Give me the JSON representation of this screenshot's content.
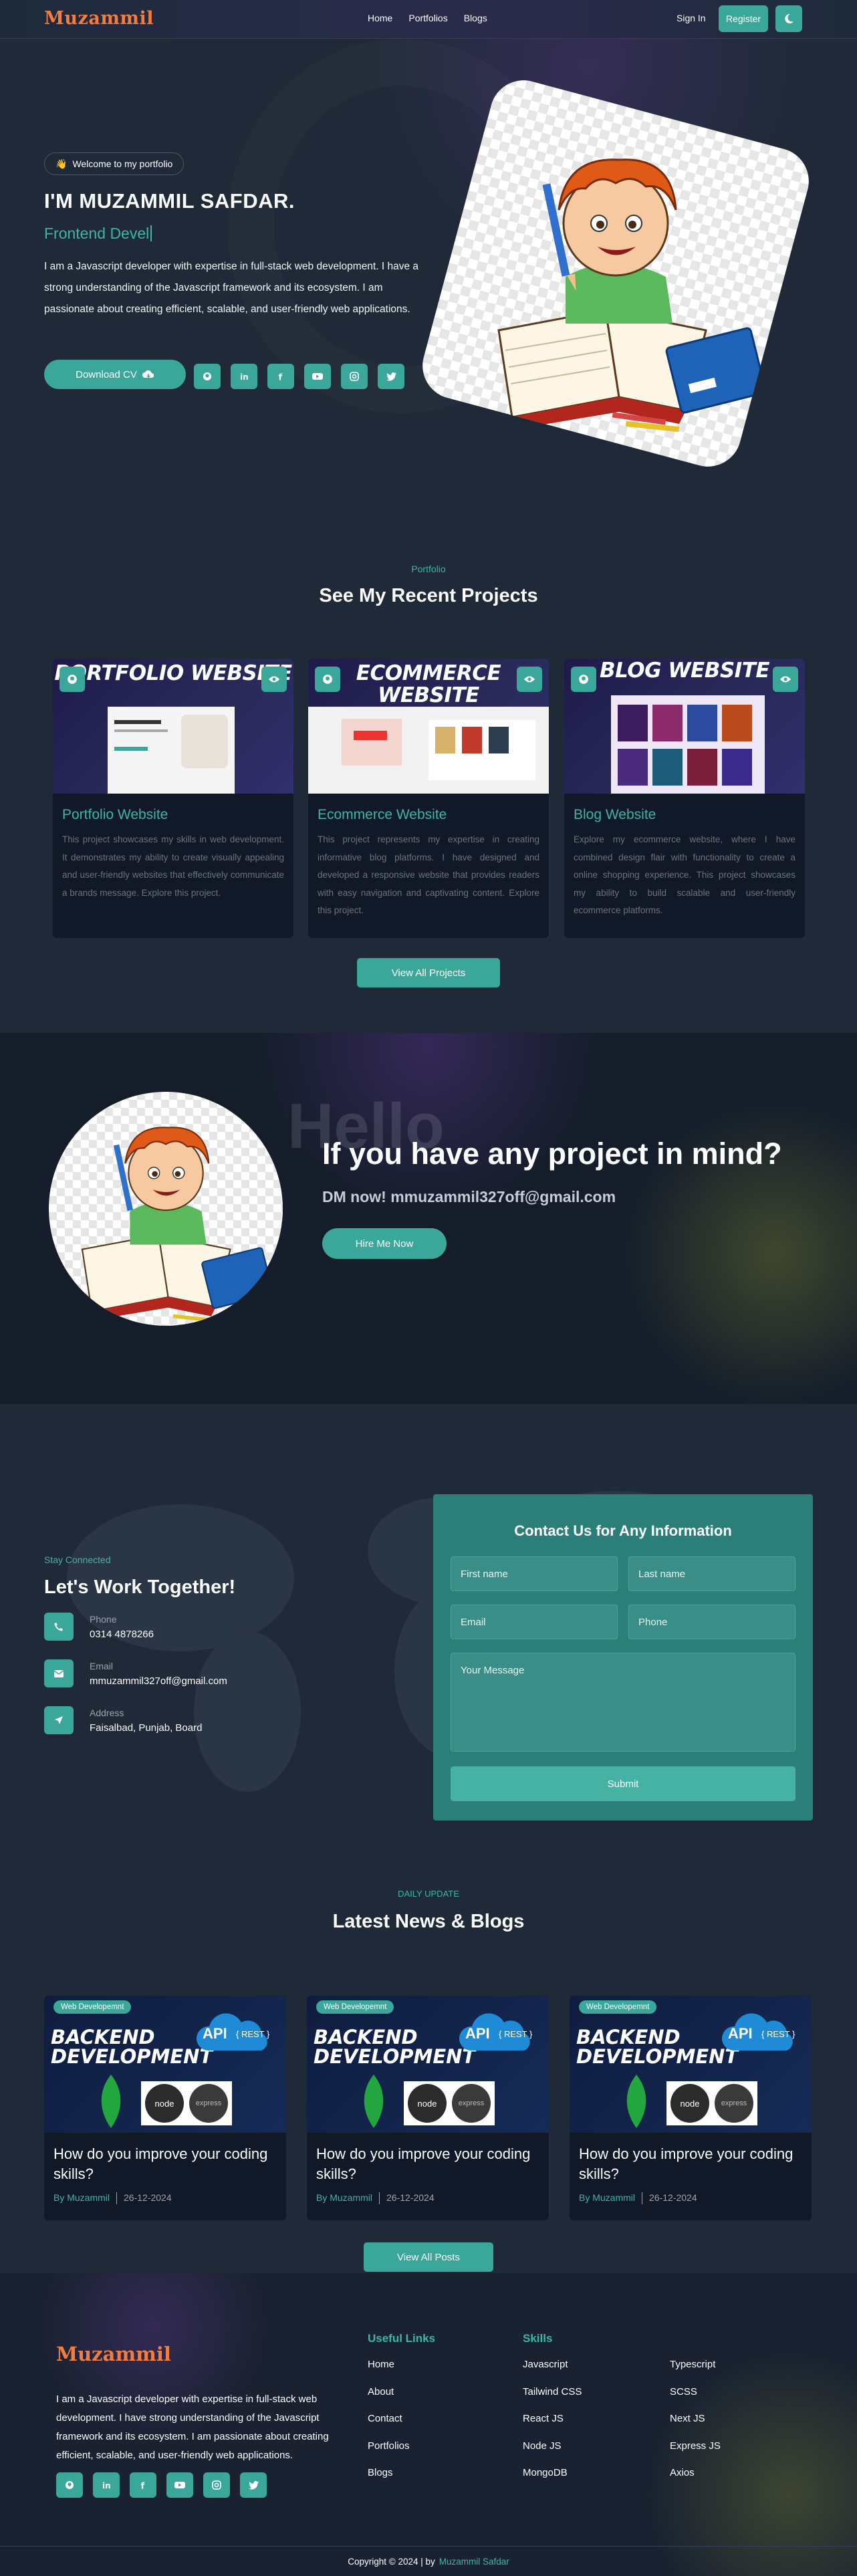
{
  "nav": {
    "logo": "Muzammil",
    "links": [
      "Home",
      "Portfolios",
      "Blogs"
    ],
    "signin": "Sign In",
    "register": "Register"
  },
  "hero": {
    "badge": "Welcome to my portfolio",
    "badge_icon": "waving-hand-icon",
    "name": "I'M MUZAMMIL SAFDAR.",
    "role": "Frontend Devel",
    "description": "I am a Javascript developer with expertise in full-stack web development. I have a strong understanding of the Javascript framework and its ecosystem. I am passionate about creating efficient, scalable, and user-friendly web applications.",
    "cv_button": "Download CV",
    "socials": [
      "github-icon",
      "linkedin-icon",
      "facebook-icon",
      "youtube-icon",
      "instagram-icon",
      "twitter-icon"
    ]
  },
  "projects": {
    "kicker": "Portfolio",
    "title": "See My Recent Projects",
    "items": [
      {
        "image_title": "PORTFOLIO WEBSITE",
        "title": "Portfolio Website",
        "description": "This project showcases my skills in web development. It demonstrates my ability to create visually appealing and user-friendly websites that effectively communicate a brands message. Explore this project."
      },
      {
        "image_title": "ECOMMERCE WEBSITE",
        "title": "Ecommerce Website",
        "description": "This project represents my expertise in creating informative blog platforms. I have designed and developed a responsive website that provides readers with easy navigation and captivating content. Explore this project."
      },
      {
        "image_title": "BLOG WEBSITE",
        "title": "Blog Website",
        "description": "Explore my ecommerce website, where I have combined design flair with functionality to create a online shopping experience. This project showcases my ability to build scalable and user-friendly ecommerce platforms."
      }
    ],
    "view_all": "View All Projects"
  },
  "cta": {
    "watermark": "Hello",
    "title": "If you have any project in mind?",
    "subtitle": "DM now! mmuzammil327off@gmail.com",
    "button": "Hire Me Now"
  },
  "contact": {
    "kicker": "Stay Connected",
    "title": "Let's Work Together!",
    "items": [
      {
        "icon": "phone-icon",
        "label": "Phone",
        "value": "0314 4878266"
      },
      {
        "icon": "mail-icon",
        "label": "Email",
        "value": "mmuzammil327off@gmail.com"
      },
      {
        "icon": "location-arrow-icon",
        "label": "Address",
        "value": "Faisalbad, Punjab, Board"
      }
    ],
    "form": {
      "title": "Contact Us for Any Information",
      "first_name": "First name",
      "last_name": "Last name",
      "email": "Email",
      "phone": "Phone",
      "message": "Your Message",
      "submit": "Submit"
    }
  },
  "blogs": {
    "kicker": "DAILY UPDATE",
    "title": "Latest News & Blogs",
    "items": [
      {
        "tag": "Web Developemnt",
        "image_title": "BACKEND DEVELOPMENT",
        "title": "How do you improve your coding skills?",
        "by": "By Muzammil",
        "date": "26-12-2024"
      },
      {
        "tag": "Web Developemnt",
        "image_title": "BACKEND DEVELOPMENT",
        "title": "How do you improve your coding skills?",
        "by": "By Muzammil",
        "date": "26-12-2024"
      },
      {
        "tag": "Web Developemnt",
        "image_title": "BACKEND DEVELOPMENT",
        "title": "How do you improve your coding skills?",
        "by": "By Muzammil",
        "date": "26-12-2024"
      }
    ],
    "image_labels": {
      "api": "API",
      "rest": "{ REST }",
      "node": "node",
      "express": "express"
    },
    "view_all": "View All Posts"
  },
  "footer": {
    "logo": "Muzammil",
    "description": "I am a Javascript developer with expertise in full-stack web development. I have strong understanding of the Javascript framework and its ecosystem. I am passionate about creating efficient, scalable, and user-friendly web applications.",
    "useful_links_title": "Useful Links",
    "useful_links": [
      "Home",
      "About",
      "Contact",
      "Portfolios",
      "Blogs"
    ],
    "skills_title": "Skills",
    "skills_col1": [
      "Javascript",
      "Tailwind CSS",
      "React JS",
      "Node JS",
      "MongoDB"
    ],
    "skills_col2": [
      "Typescript",
      "SCSS",
      "Next JS",
      "Express JS",
      "Axios"
    ],
    "copyright": "Copyright © 2024 | by",
    "copyright_name": "Muzammil Safdar"
  },
  "colors": {
    "accent": "#3aa79a",
    "logo": "#f47c3c",
    "background": "#1f2937"
  }
}
